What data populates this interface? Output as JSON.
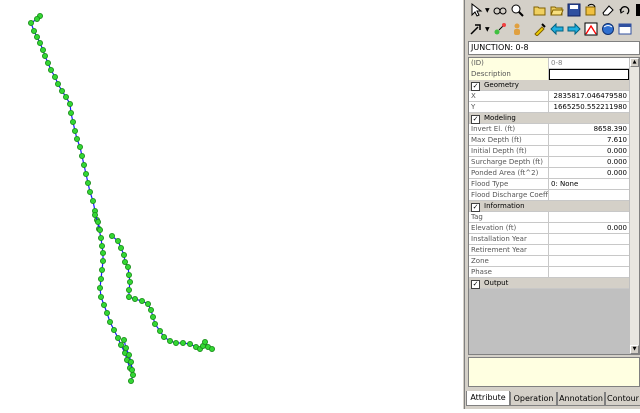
{
  "toolbar": {
    "row1": [
      "pointer-tool",
      "pan-tool",
      "zoom-tool",
      "open-icon",
      "folder-icon",
      "save-icon",
      "undo-icon",
      "erase-icon",
      "redo-icon",
      "grid-icon"
    ],
    "row2": [
      "link-tool",
      "node-tool",
      "person-icon",
      "dropper-icon",
      "back-arrow-icon",
      "forward-arrow-icon",
      "network-icon",
      "sphere-icon",
      "table-icon"
    ]
  },
  "selector": {
    "value": "JUNCTION: 0-8"
  },
  "properties": {
    "rows": [
      {
        "type": "row",
        "cls": "id",
        "label": "(ID)",
        "value": "0-8",
        "align": "left"
      },
      {
        "type": "row",
        "cls": "desc",
        "label": "Description",
        "value": "",
        "align": "left"
      },
      {
        "type": "section",
        "label": "Geometry"
      },
      {
        "type": "row",
        "label": "X",
        "value": "2835817.046479580"
      },
      {
        "type": "row",
        "label": "Y",
        "value": "1665250.552211980"
      },
      {
        "type": "section",
        "label": "Modeling"
      },
      {
        "type": "row",
        "label": "Invert El. (ft)",
        "value": "8658.390"
      },
      {
        "type": "row",
        "label": "Max Depth (ft)",
        "value": "7.610"
      },
      {
        "type": "row",
        "label": "Initial Depth (ft)",
        "value": "0.000"
      },
      {
        "type": "row",
        "label": "Surcharge Depth (ft)",
        "value": "0.000"
      },
      {
        "type": "row",
        "label": "Ponded Area (ft^2)",
        "value": "0.000"
      },
      {
        "type": "row",
        "label": "Flood Type",
        "value": "0: None",
        "align": "left"
      },
      {
        "type": "row",
        "label": "Flood Discharge Coeffic",
        "value": "",
        "align": "left"
      },
      {
        "type": "section",
        "label": "Information"
      },
      {
        "type": "row",
        "label": "Tag",
        "value": ""
      },
      {
        "type": "row",
        "label": "Elevation (ft)",
        "value": "0.000"
      },
      {
        "type": "row",
        "label": "Installation Year",
        "value": ""
      },
      {
        "type": "row",
        "label": "Retirement Year",
        "value": ""
      },
      {
        "type": "row",
        "label": "Zone",
        "value": ""
      },
      {
        "type": "row",
        "label": "Phase",
        "value": ""
      },
      {
        "type": "section",
        "label": "Output"
      }
    ]
  },
  "tabs": [
    {
      "label": "Attribute",
      "active": true
    },
    {
      "label": "Operation",
      "active": false
    },
    {
      "label": "Annotation",
      "active": false
    },
    {
      "label": "Contour",
      "active": false
    }
  ],
  "colors": {
    "node": "#33d633",
    "pipe": "#1a1aff",
    "panel": "#d4d0c8"
  }
}
